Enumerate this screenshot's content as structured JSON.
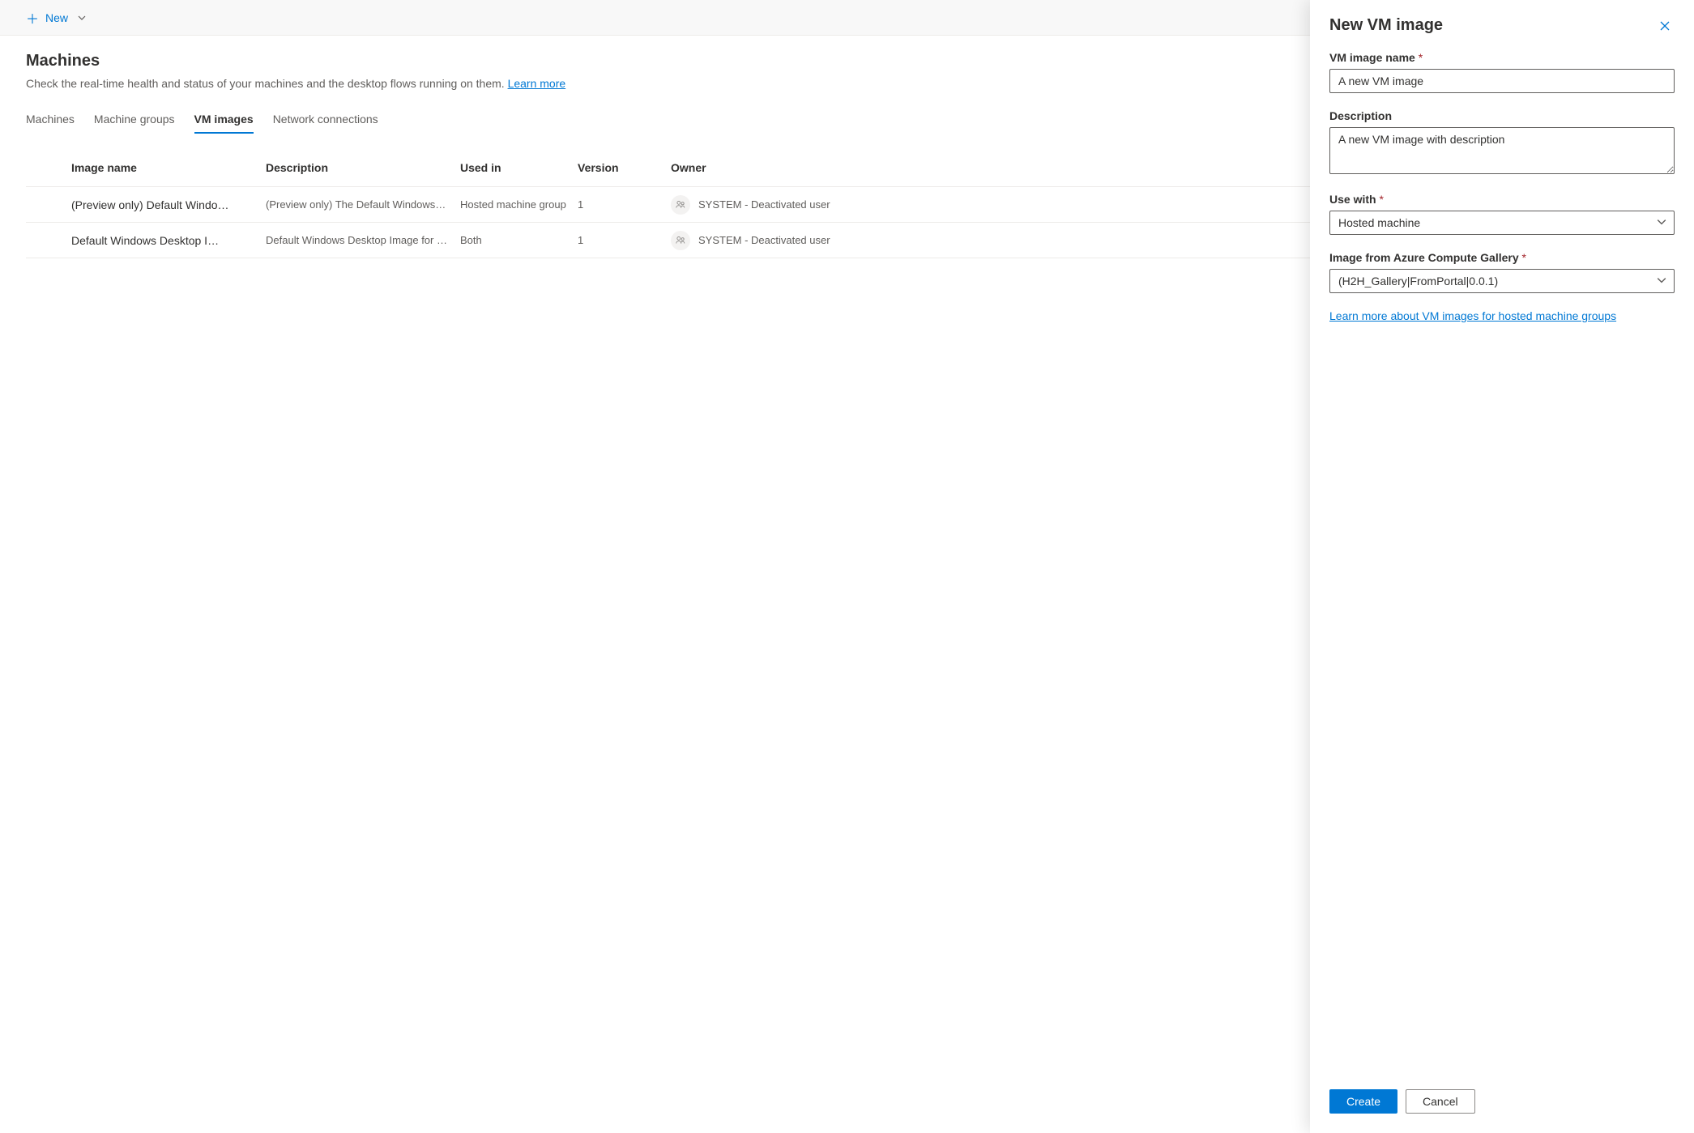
{
  "commandBar": {
    "newLabel": "New"
  },
  "header": {
    "title": "Machines",
    "subtitle": "Check the real-time health and status of your machines and the desktop flows running on them. ",
    "learnMoreLabel": "Learn more"
  },
  "tabs": [
    {
      "label": "Machines"
    },
    {
      "label": "Machine groups"
    },
    {
      "label": "VM images"
    },
    {
      "label": "Network connections"
    }
  ],
  "activeTabIndex": 2,
  "table": {
    "columns": {
      "name": "Image name",
      "description": "Description",
      "usedIn": "Used in",
      "version": "Version",
      "owner": "Owner"
    },
    "rows": [
      {
        "name": "(Preview only) Default Windo…",
        "description": "(Preview only) The Default Windows Desk…",
        "usedIn": "Hosted machine group",
        "version": "1",
        "owner": "SYSTEM - Deactivated user"
      },
      {
        "name": "Default Windows Desktop I…",
        "description": "Default Windows Desktop Image for use i…",
        "usedIn": "Both",
        "version": "1",
        "owner": "SYSTEM - Deactivated user"
      }
    ]
  },
  "panel": {
    "title": "New VM image",
    "fields": {
      "nameLabel": "VM image name",
      "nameValue": "A new VM image",
      "descLabel": "Description",
      "descValue": "A new VM image with description",
      "useWithLabel": "Use with",
      "useWithValue": "Hosted machine",
      "galleryLabel": "Image from Azure Compute Gallery",
      "galleryValue": "(H2H_Gallery|FromPortal|0.0.1)"
    },
    "learnMoreLink": "Learn more about VM images for hosted machine groups",
    "createLabel": "Create",
    "cancelLabel": "Cancel"
  }
}
